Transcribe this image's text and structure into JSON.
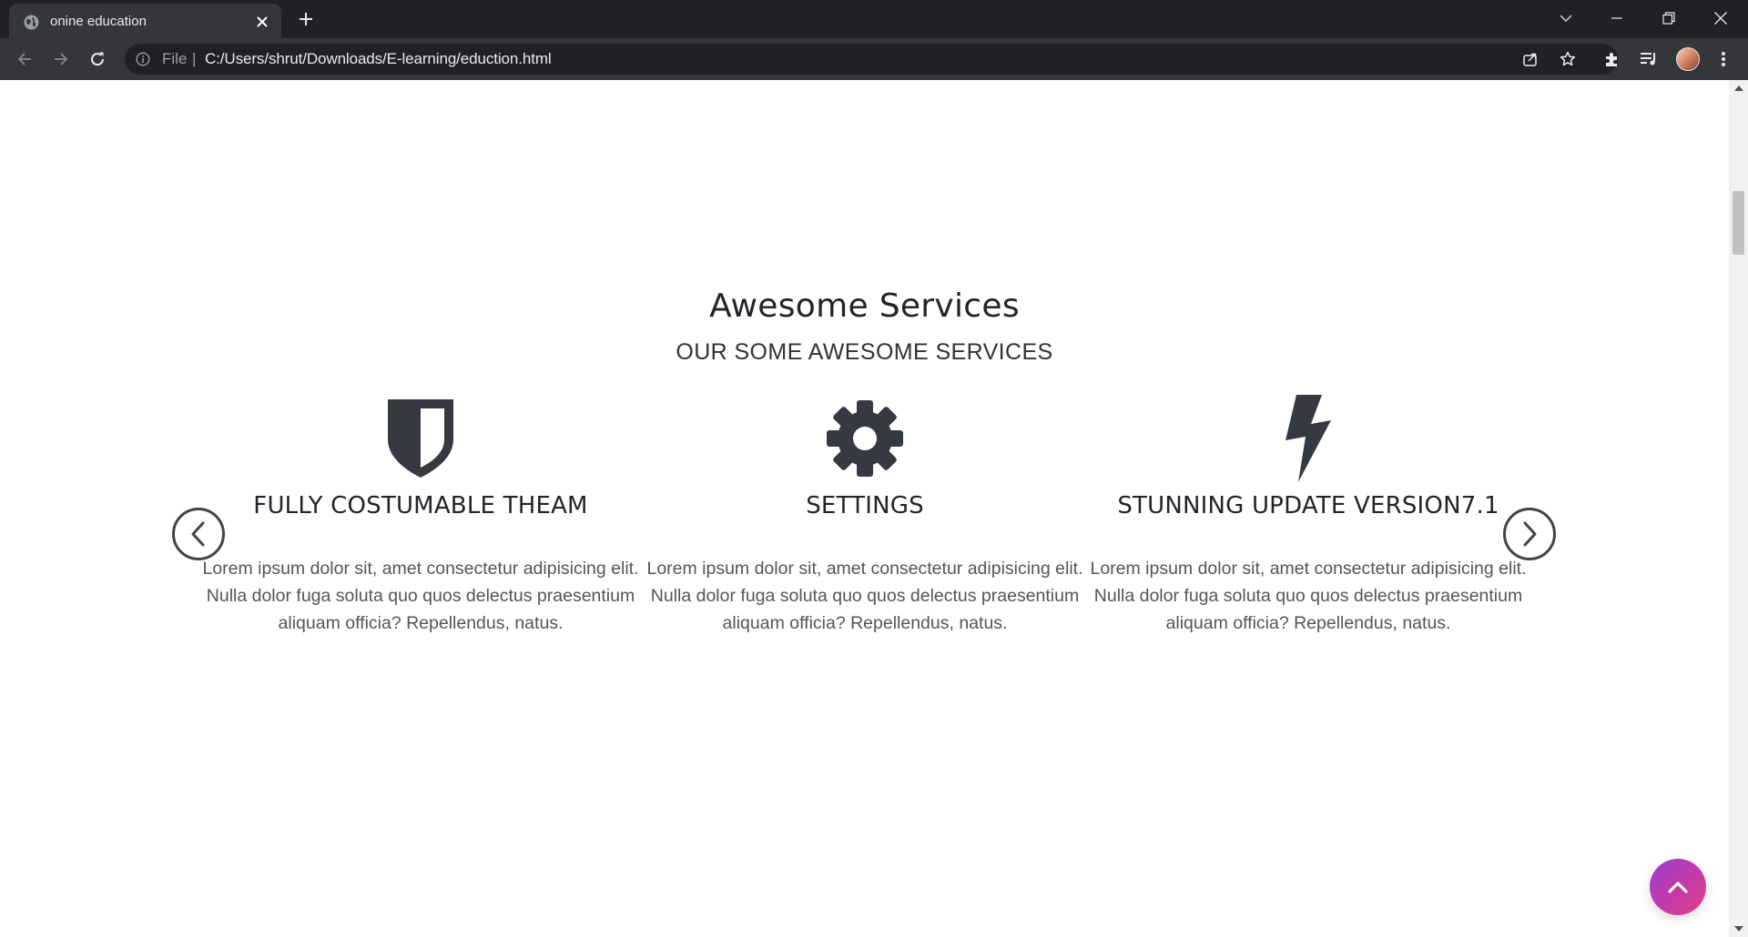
{
  "browser": {
    "tab_title": "onine education",
    "url_scheme": "File",
    "url_separator": "|",
    "url": "C:/Users/shrut/Downloads/E-learning/eduction.html"
  },
  "section": {
    "title": "Awesome Services",
    "subtitle": "OUR SOME AWESOME SERVICES"
  },
  "services": [
    {
      "icon": "shield-icon",
      "title": "FULLY COSTUMABLE THEAM",
      "text": "Lorem ipsum dolor sit, amet consectetur adipisicing elit. Nulla dolor fuga soluta quo quos delectus praesentium aliquam officia? Repellendus, natus."
    },
    {
      "icon": "gear-icon",
      "title": "SETTINGS",
      "text": "Lorem ipsum dolor sit, amet consectetur adipisicing elit. Nulla dolor fuga soluta quo quos delectus praesentium aliquam officia? Repellendus, natus."
    },
    {
      "icon": "bolt-icon",
      "title": "STUNNING UPDATE VERSION7.1",
      "text": "Lorem ipsum dolor sit, amet consectetur adipisicing elit. Nulla dolor fuga soluta quo quos delectus praesentium aliquam officia? Repellendus, natus."
    }
  ],
  "colors": {
    "chrome_dark": "#202124",
    "chrome_toolbar": "#35363a",
    "icon_dark": "#343a40",
    "back_to_top_gradient_start": "#9b3fd0",
    "back_to_top_gradient_end": "#e04486"
  }
}
